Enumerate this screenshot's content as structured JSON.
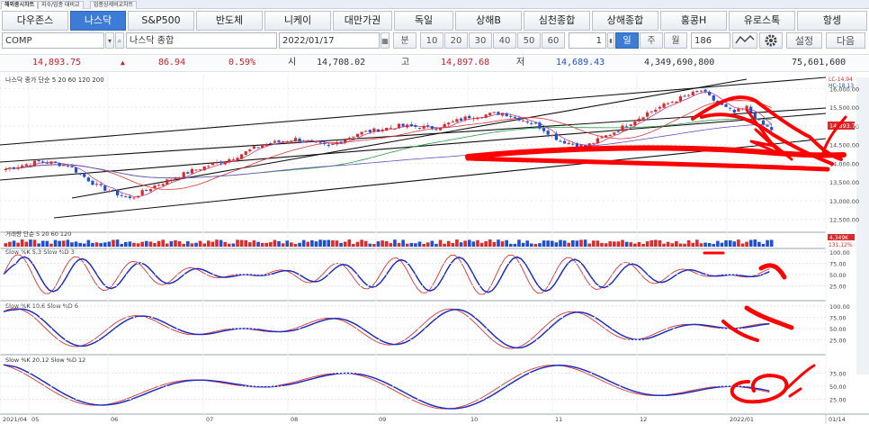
{
  "top_tabs": [
    "해외종시차트",
    "지수/업종 대비교",
    "업종상세비교차트"
  ],
  "nav_buttons": [
    {
      "label": "다우존스",
      "active": false
    },
    {
      "label": "나스닥",
      "active": true
    },
    {
      "label": "S&P500",
      "active": false
    },
    {
      "label": "반도체",
      "active": false
    },
    {
      "label": "니케이",
      "active": false
    },
    {
      "label": "대만가권",
      "active": false
    },
    {
      "label": "독일",
      "active": false
    },
    {
      "label": "상해B",
      "active": false
    },
    {
      "label": "심천종합",
      "active": false
    },
    {
      "label": "상해종합",
      "active": false
    },
    {
      "label": "홍콩H",
      "active": false
    },
    {
      "label": "유로스톡",
      "active": false
    },
    {
      "label": "항셍",
      "active": false
    }
  ],
  "controls": {
    "symbol_code": "COMP",
    "symbol_name": "나스닥 종합",
    "date": "2022/01/17",
    "interval_label": "분",
    "periods": [
      "10",
      "20",
      "30",
      "40",
      "50",
      "60"
    ],
    "count_value": "1",
    "tf_buttons": [
      "일",
      "주",
      "월"
    ],
    "active_tf": "일",
    "bars_count": "186",
    "settings_label": "설정",
    "next_label": "다음"
  },
  "quote": {
    "price": "14,893.75",
    "arrow": "▲",
    "change": "86.94",
    "pct": "0.59%",
    "open_label": "시",
    "open": "14,708.02",
    "high_label": "고",
    "high": "14,897.68",
    "low_label": "저",
    "low": "14,689.43",
    "volume": "4,349,690,800",
    "amount": "75,601,600"
  },
  "chart_data": {
    "type": "candlestick",
    "price_panel": {
      "legend": "나스닥 종가 단순 5 20 60 120 200",
      "yticks": [
        "16,000.00",
        "15,500.00",
        "15,000.00",
        "14,500.00",
        "14,000.00",
        "13,500.00",
        "13,000.00",
        "12,500.00"
      ],
      "ylim": [
        12300,
        16250
      ],
      "top_labels": [
        "LC-14.94",
        "HC-18.13"
      ],
      "last_price_label": "14,893.75",
      "x_labels": [
        "2021/04",
        "05",
        "06",
        "07",
        "08",
        "09",
        "10",
        "11",
        "12",
        "2022/01",
        "01/14"
      ]
    },
    "volume_panel": {
      "legend": "거래량 단순 5 20 60 120",
      "labels": [
        "4,349K",
        "131.12%"
      ]
    },
    "stoch_panels": [
      {
        "legend": "Slow %K 5,3  Slow %D 3",
        "ticks": [
          "100.00",
          "75.00",
          "50.00",
          "25.00"
        ]
      },
      {
        "legend": "Slow %K 10,6  Slow %D 6",
        "ticks": [
          "100.00",
          "75.00",
          "50.00",
          "25.00"
        ]
      },
      {
        "legend": "Slow %K 20,12  Slow %D 12",
        "ticks": [
          "75.00",
          "50.00",
          "25.00"
        ]
      }
    ]
  },
  "colors": {
    "accent": "#3d7cd6",
    "up": "#d92b2b",
    "down": "#1f4fd1",
    "annotation": "#ff0000"
  }
}
